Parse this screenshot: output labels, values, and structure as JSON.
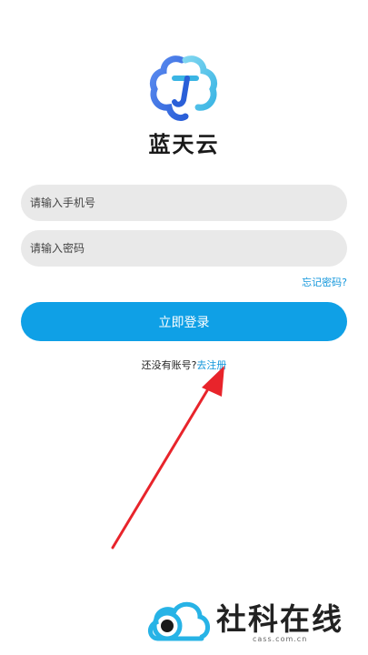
{
  "brand": {
    "name": "蓝天云",
    "colors": {
      "blue": "#2a6fe0",
      "cyan": "#4fc3e8"
    }
  },
  "login_form": {
    "phone_placeholder": "请输入手机号",
    "password_placeholder": "请输入密码",
    "forgot_password": "忘记密码?",
    "login_button": "立即登录",
    "no_account_text": "还没有账号?",
    "register_link": "去注册",
    "accent_color": "#0fa0e6"
  },
  "annotation": {
    "arrow_color": "#e8242b"
  },
  "watermark": {
    "text": "社科在线",
    "subtext": "cass.com.cn"
  }
}
